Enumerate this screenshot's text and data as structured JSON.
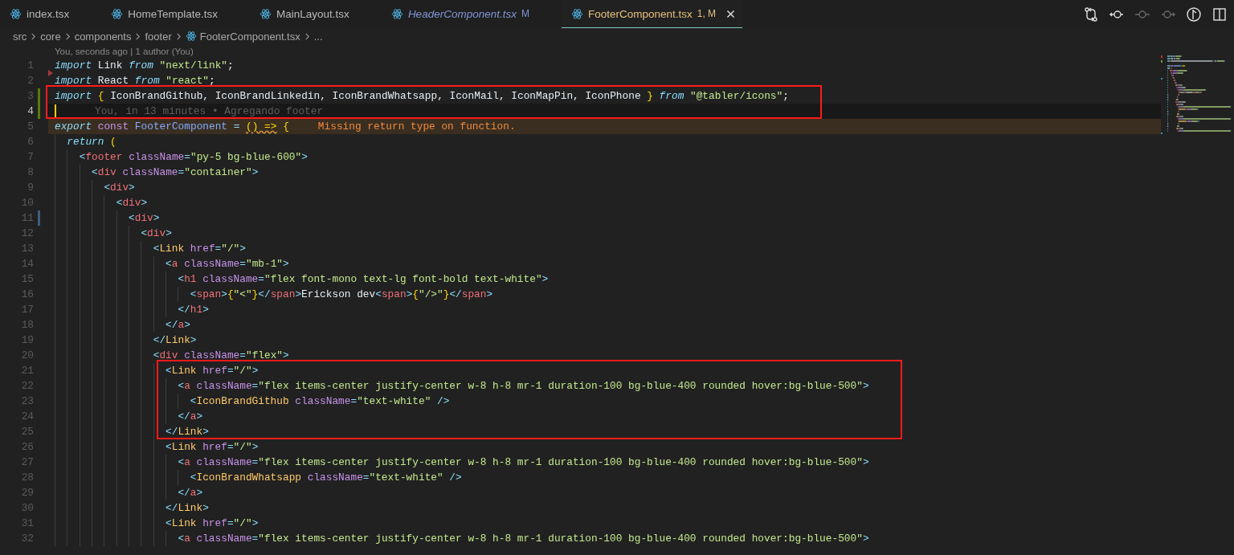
{
  "tabs": [
    {
      "label": "index.tsx",
      "selected": false,
      "preview": false,
      "modified": false,
      "has_error": false
    },
    {
      "label": "HomeTemplate.tsx",
      "selected": false,
      "preview": false,
      "modified": false,
      "has_error": false
    },
    {
      "label": "MainLayout.tsx",
      "selected": false,
      "preview": false,
      "modified": false,
      "has_error": false
    },
    {
      "label": "HeaderComponent.tsx",
      "selected": false,
      "preview": true,
      "modified": true,
      "has_error": false,
      "badge": "M"
    },
    {
      "label": "FooterComponent.tsx",
      "selected": true,
      "preview": false,
      "modified": true,
      "has_error": true,
      "badge": "1, M"
    }
  ],
  "toolbar": [
    {
      "kind": "compare",
      "disabled": false
    },
    {
      "kind": "previous",
      "disabled": false
    },
    {
      "kind": "commit",
      "disabled": true
    },
    {
      "kind": "next",
      "disabled": true
    },
    {
      "kind": "branch",
      "disabled": false
    },
    {
      "kind": "split",
      "disabled": false
    }
  ],
  "breadcrumb": [
    {
      "label": "src",
      "kind": "folder"
    },
    {
      "label": "core",
      "kind": "folder"
    },
    {
      "label": "components",
      "kind": "folder"
    },
    {
      "label": "footer",
      "kind": "folder"
    },
    {
      "label": "FooterComponent.tsx",
      "kind": "file"
    },
    {
      "label": "...",
      "kind": "more"
    }
  ],
  "codelens": "You, seconds ago | 1 author (You)",
  "segments": [
    {
      "boxed": false,
      "lines": [
        {
          "n": "1",
          "kind": "plain",
          "current": false,
          "tokens": [
            {
              "text": "import ",
              "kind": "kw"
            },
            {
              "text": "Link ",
              "kind": "id"
            },
            {
              "text": "from ",
              "kind": "kw"
            },
            {
              "text": "\"next/link\"",
              "kind": "str"
            },
            {
              "text": ";",
              "kind": "id"
            }
          ]
        },
        {
          "n": "2",
          "kind": "deleted",
          "current": false,
          "tokens": [
            {
              "text": "import ",
              "kind": "kw"
            },
            {
              "text": "React ",
              "kind": "id"
            },
            {
              "text": "from ",
              "kind": "kw"
            },
            {
              "text": "\"react\"",
              "kind": "str"
            },
            {
              "text": ";",
              "kind": "id"
            }
          ]
        }
      ]
    },
    {
      "boxed": true,
      "lines": [
        {
          "n": "3",
          "kind": "added",
          "current": false,
          "tokens": [
            {
              "text": "import ",
              "kind": "kw"
            },
            {
              "text": "{",
              "kind": "pun"
            },
            {
              "text": " IconBrandGithub, IconBrandLinkedin, IconBrandWhatsapp, IconMail, IconMapPin, IconPhone ",
              "kind": "id"
            },
            {
              "text": "} ",
              "kind": "pun"
            },
            {
              "text": "from ",
              "kind": "kw"
            },
            {
              "text": "\"@tabler/icons\"",
              "kind": "str"
            },
            {
              "text": ";",
              "kind": "id"
            }
          ]
        },
        {
          "n": "4",
          "kind": "added",
          "current": true,
          "blame": "You, in 13 minutes • Agregando footer"
        }
      ]
    },
    {
      "boxed": false,
      "lines": [
        {
          "n": "5",
          "kind": "plain",
          "current": false,
          "diagnostic": "Missing return type on function.",
          "tokens": [
            {
              "text": "export ",
              "kind": "kw"
            },
            {
              "text": "const ",
              "kind": "st"
            },
            {
              "text": "FooterComponent ",
              "kind": "fn"
            },
            {
              "text": "= ",
              "kind": "op"
            },
            {
              "text": "() =>",
              "kind": "warn"
            },
            {
              "text": " {",
              "kind": "pun"
            }
          ]
        },
        {
          "n": "6",
          "kind": "plain",
          "current": false,
          "tokens": [
            {
              "text": "  return ",
              "kind": "kw"
            },
            {
              "text": "(",
              "kind": "pun"
            }
          ]
        },
        {
          "n": "7",
          "kind": "plain",
          "current": false,
          "tokens": [
            {
              "text": "    <",
              "kind": "op"
            },
            {
              "text": "footer ",
              "kind": "tag"
            },
            {
              "text": "className",
              "kind": "attr"
            },
            {
              "text": "=",
              "kind": "op"
            },
            {
              "text": "\"py-5 bg-blue-600\"",
              "kind": "str"
            },
            {
              "text": ">",
              "kind": "op"
            }
          ]
        },
        {
          "n": "8",
          "kind": "plain",
          "current": false,
          "tokens": [
            {
              "text": "      <",
              "kind": "op"
            },
            {
              "text": "div ",
              "kind": "tag"
            },
            {
              "text": "className",
              "kind": "attr"
            },
            {
              "text": "=",
              "kind": "op"
            },
            {
              "text": "\"container\"",
              "kind": "str"
            },
            {
              "text": ">",
              "kind": "op"
            }
          ]
        },
        {
          "n": "9",
          "kind": "plain",
          "current": false,
          "tokens": [
            {
              "text": "        <",
              "kind": "op"
            },
            {
              "text": "div",
              "kind": "tag"
            },
            {
              "text": ">",
              "kind": "op"
            }
          ]
        },
        {
          "n": "10",
          "kind": "plain",
          "current": false,
          "tokens": [
            {
              "text": "          <",
              "kind": "op"
            },
            {
              "text": "div",
              "kind": "tag"
            },
            {
              "text": ">",
              "kind": "op"
            }
          ]
        },
        {
          "n": "11",
          "kind": "modified",
          "current": false,
          "tokens": [
            {
              "text": "            <",
              "kind": "op"
            },
            {
              "text": "div",
              "kind": "tag"
            },
            {
              "text": ">",
              "kind": "op"
            }
          ]
        },
        {
          "n": "12",
          "kind": "plain",
          "current": false,
          "tokens": [
            {
              "text": "              <",
              "kind": "op"
            },
            {
              "text": "div",
              "kind": "tag"
            },
            {
              "text": ">",
              "kind": "op"
            }
          ]
        },
        {
          "n": "13",
          "kind": "plain",
          "current": false,
          "tokens": [
            {
              "text": "                <",
              "kind": "op"
            },
            {
              "text": "Link ",
              "kind": "comp"
            },
            {
              "text": "href",
              "kind": "attr"
            },
            {
              "text": "=",
              "kind": "op"
            },
            {
              "text": "\"/\"",
              "kind": "str"
            },
            {
              "text": ">",
              "kind": "op"
            }
          ]
        },
        {
          "n": "14",
          "kind": "plain",
          "current": false,
          "tokens": [
            {
              "text": "                  <",
              "kind": "op"
            },
            {
              "text": "a ",
              "kind": "tag"
            },
            {
              "text": "className",
              "kind": "attr"
            },
            {
              "text": "=",
              "kind": "op"
            },
            {
              "text": "\"mb-1\"",
              "kind": "str"
            },
            {
              "text": ">",
              "kind": "op"
            }
          ]
        },
        {
          "n": "15",
          "kind": "plain",
          "current": false,
          "tokens": [
            {
              "text": "                    <",
              "kind": "op"
            },
            {
              "text": "h1 ",
              "kind": "tag"
            },
            {
              "text": "className",
              "kind": "attr"
            },
            {
              "text": "=",
              "kind": "op"
            },
            {
              "text": "\"flex font-mono text-lg font-bold text-white\"",
              "kind": "str"
            },
            {
              "text": ">",
              "kind": "op"
            }
          ]
        },
        {
          "n": "16",
          "kind": "plain",
          "current": false,
          "tokens": [
            {
              "text": "                      <",
              "kind": "op"
            },
            {
              "text": "span",
              "kind": "tag"
            },
            {
              "text": ">",
              "kind": "op"
            },
            {
              "text": "{",
              "kind": "pun"
            },
            {
              "text": "\"<\"",
              "kind": "str"
            },
            {
              "text": "}",
              "kind": "pun"
            },
            {
              "text": "</",
              "kind": "op"
            },
            {
              "text": "span",
              "kind": "tag"
            },
            {
              "text": ">",
              "kind": "op"
            },
            {
              "text": "Erickson dev",
              "kind": "id"
            },
            {
              "text": "<",
              "kind": "op"
            },
            {
              "text": "span",
              "kind": "tag"
            },
            {
              "text": ">",
              "kind": "op"
            },
            {
              "text": "{",
              "kind": "pun"
            },
            {
              "text": "\"/>\"",
              "kind": "str"
            },
            {
              "text": "}",
              "kind": "pun"
            },
            {
              "text": "</",
              "kind": "op"
            },
            {
              "text": "span",
              "kind": "tag"
            },
            {
              "text": ">",
              "kind": "op"
            }
          ]
        },
        {
          "n": "17",
          "kind": "plain",
          "current": false,
          "tokens": [
            {
              "text": "                    </",
              "kind": "op"
            },
            {
              "text": "h1",
              "kind": "tag"
            },
            {
              "text": ">",
              "kind": "op"
            }
          ]
        },
        {
          "n": "18",
          "kind": "plain",
          "current": false,
          "tokens": [
            {
              "text": "                  </",
              "kind": "op"
            },
            {
              "text": "a",
              "kind": "tag"
            },
            {
              "text": ">",
              "kind": "op"
            }
          ]
        },
        {
          "n": "19",
          "kind": "plain",
          "current": false,
          "tokens": [
            {
              "text": "                </",
              "kind": "op"
            },
            {
              "text": "Link",
              "kind": "comp"
            },
            {
              "text": ">",
              "kind": "op"
            }
          ]
        },
        {
          "n": "20",
          "kind": "plain",
          "current": false,
          "tokens": [
            {
              "text": "                <",
              "kind": "op"
            },
            {
              "text": "div ",
              "kind": "tag"
            },
            {
              "text": "className",
              "kind": "attr"
            },
            {
              "text": "=",
              "kind": "op"
            },
            {
              "text": "\"flex\"",
              "kind": "str"
            },
            {
              "text": ">",
              "kind": "op"
            }
          ]
        }
      ]
    },
    {
      "boxed": true,
      "lines": [
        {
          "n": "21",
          "kind": "plain",
          "current": false,
          "tokens": [
            {
              "text": "                  <",
              "kind": "op"
            },
            {
              "text": "Link ",
              "kind": "comp"
            },
            {
              "text": "href",
              "kind": "attr"
            },
            {
              "text": "=",
              "kind": "op"
            },
            {
              "text": "\"/\"",
              "kind": "str"
            },
            {
              "text": ">",
              "kind": "op"
            }
          ]
        },
        {
          "n": "22",
          "kind": "plain",
          "current": false,
          "tokens": [
            {
              "text": "                    <",
              "kind": "op"
            },
            {
              "text": "a ",
              "kind": "tag"
            },
            {
              "text": "className",
              "kind": "attr"
            },
            {
              "text": "=",
              "kind": "op"
            },
            {
              "text": "\"flex items-center justify-center w-8 h-8 mr-1 duration-100 bg-blue-400 rounded hover:bg-blue-500\"",
              "kind": "str"
            },
            {
              "text": ">",
              "kind": "op"
            }
          ]
        },
        {
          "n": "23",
          "kind": "plain",
          "current": false,
          "tokens": [
            {
              "text": "                      <",
              "kind": "op"
            },
            {
              "text": "IconBrandGithub ",
              "kind": "comp"
            },
            {
              "text": "className",
              "kind": "attr"
            },
            {
              "text": "=",
              "kind": "op"
            },
            {
              "text": "\"text-white\" ",
              "kind": "str"
            },
            {
              "text": "/>",
              "kind": "op"
            }
          ]
        },
        {
          "n": "24",
          "kind": "plain",
          "current": false,
          "tokens": [
            {
              "text": "                    </",
              "kind": "op"
            },
            {
              "text": "a",
              "kind": "tag"
            },
            {
              "text": ">",
              "kind": "op"
            }
          ]
        },
        {
          "n": "25",
          "kind": "plain",
          "current": false,
          "tokens": [
            {
              "text": "                  </",
              "kind": "op"
            },
            {
              "text": "Link",
              "kind": "comp"
            },
            {
              "text": ">",
              "kind": "op"
            }
          ]
        }
      ]
    },
    {
      "boxed": false,
      "lines": [
        {
          "n": "26",
          "kind": "plain",
          "current": false,
          "tokens": [
            {
              "text": "                  <",
              "kind": "op"
            },
            {
              "text": "Link ",
              "kind": "comp"
            },
            {
              "text": "href",
              "kind": "attr"
            },
            {
              "text": "=",
              "kind": "op"
            },
            {
              "text": "\"/\"",
              "kind": "str"
            },
            {
              "text": ">",
              "kind": "op"
            }
          ]
        },
        {
          "n": "27",
          "kind": "plain",
          "current": false,
          "tokens": [
            {
              "text": "                    <",
              "kind": "op"
            },
            {
              "text": "a ",
              "kind": "tag"
            },
            {
              "text": "className",
              "kind": "attr"
            },
            {
              "text": "=",
              "kind": "op"
            },
            {
              "text": "\"flex items-center justify-center w-8 h-8 mr-1 duration-100 bg-blue-400 rounded hover:bg-blue-500\"",
              "kind": "str"
            },
            {
              "text": ">",
              "kind": "op"
            }
          ]
        },
        {
          "n": "28",
          "kind": "plain",
          "current": false,
          "tokens": [
            {
              "text": "                      <",
              "kind": "op"
            },
            {
              "text": "IconBrandWhatsapp ",
              "kind": "comp"
            },
            {
              "text": "className",
              "kind": "attr"
            },
            {
              "text": "=",
              "kind": "op"
            },
            {
              "text": "\"text-white\" ",
              "kind": "str"
            },
            {
              "text": "/>",
              "kind": "op"
            }
          ]
        },
        {
          "n": "29",
          "kind": "plain",
          "current": false,
          "tokens": [
            {
              "text": "                    </",
              "kind": "op"
            },
            {
              "text": "a",
              "kind": "tag"
            },
            {
              "text": ">",
              "kind": "op"
            }
          ]
        },
        {
          "n": "30",
          "kind": "plain",
          "current": false,
          "tokens": [
            {
              "text": "                  </",
              "kind": "op"
            },
            {
              "text": "Link",
              "kind": "comp"
            },
            {
              "text": ">",
              "kind": "op"
            }
          ]
        },
        {
          "n": "31",
          "kind": "plain",
          "current": false,
          "tokens": [
            {
              "text": "                  <",
              "kind": "op"
            },
            {
              "text": "Link ",
              "kind": "comp"
            },
            {
              "text": "href",
              "kind": "attr"
            },
            {
              "text": "=",
              "kind": "op"
            },
            {
              "text": "\"/\"",
              "kind": "str"
            },
            {
              "text": ">",
              "kind": "op"
            }
          ]
        },
        {
          "n": "32",
          "kind": "plain",
          "current": false,
          "tokens": [
            {
              "text": "                    <",
              "kind": "op"
            },
            {
              "text": "a ",
              "kind": "tag"
            },
            {
              "text": "className",
              "kind": "attr"
            },
            {
              "text": "=",
              "kind": "op"
            },
            {
              "text": "\"flex items-center justify-center w-8 h-8 mr-1 duration-100 bg-blue-400 rounded hover:bg-blue-500\"",
              "kind": "str"
            },
            {
              "text": ">",
              "kind": "op"
            }
          ]
        }
      ]
    }
  ]
}
